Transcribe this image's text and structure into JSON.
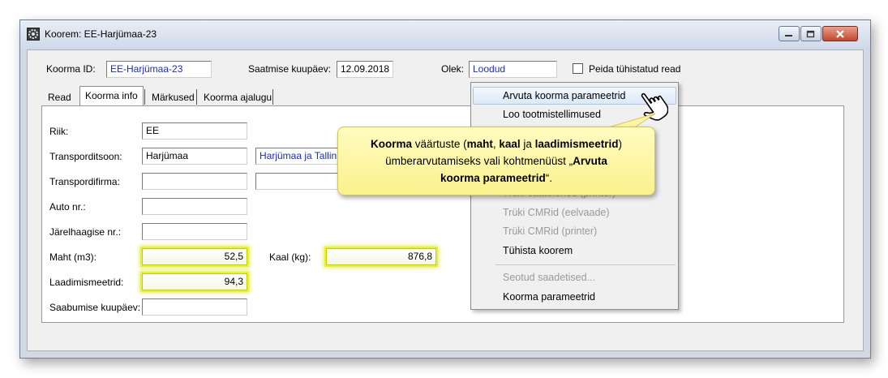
{
  "window": {
    "title": "Koorem: EE-Harjümaa-23"
  },
  "header": {
    "id_label": "Koorma ID:",
    "id_value": "EE-Harjümaa-23",
    "send_date_label": "Saatmise kuupäev:",
    "send_date_value": "12.09.2018",
    "status_label": "Olek:",
    "status_value": "Loodud",
    "hide_rows_label": "Peida tühistatud read"
  },
  "tabs": [
    {
      "label": "Read"
    },
    {
      "label": "Koorma info"
    },
    {
      "label": "Märkused"
    },
    {
      "label": "Koorma ajalugu"
    }
  ],
  "form": {
    "country_label": "Riik:",
    "country_value": "EE",
    "transport_zone_label": "Transporditsoon:",
    "transport_zone_value": "Harjümaa",
    "transport_zone_desc": "Harjümaa ja Tallinn",
    "transport_company_label": "Transpordifirma:",
    "transport_company_value": "",
    "car_label": "Auto nr.:",
    "car_value": "",
    "trailer_label": "Järelhaagise nr.:",
    "trailer_value": "",
    "volume_label": "Maht (m3):",
    "volume_value": "52,5",
    "weight_label": "Kaal (kg):",
    "weight_value": "876,8",
    "loading_meters_label": "Laadimismeetrid:",
    "loading_meters_value": "94,3",
    "arrival_date_label": "Saabumise kuupäev:",
    "arrival_date_value": ""
  },
  "context_menu": {
    "items": [
      {
        "label": "Arvuta koorma parameetrid",
        "state": "hover"
      },
      {
        "label": "Loo tootmistellimused",
        "state": "enabled"
      },
      {
        "label": "Trüki saatelehed (printer)",
        "state": "disabled"
      },
      {
        "label": "Trüki CMRid (eelvaade)",
        "state": "disabled"
      },
      {
        "label": "Trüki CMRid (printer)",
        "state": "disabled"
      },
      {
        "label": "Tühista koorem",
        "state": "enabled"
      },
      {
        "label": "Seotud saadetised...",
        "state": "disabled"
      },
      {
        "label": "Koorma parameetrid",
        "state": "enabled"
      }
    ]
  },
  "callout": {
    "line1_b1": "Koorma",
    "line1_t1": " väärtuste (",
    "line1_b2": "maht",
    "line1_t2": ", ",
    "line1_b3": "kaal",
    "line1_t3": " ja ",
    "line1_b4": "laadimismeetrid",
    "line1_t4": ")",
    "line2_t1": "ümberarvutamiseks vali kohtmenüüst „",
    "line2_b1": "Arvuta",
    "line3_b1": "koorma parameetrid",
    "line3_t1": "“."
  },
  "colors": {
    "highlight": "#e7f03a",
    "callout_fill": "#fbf18d",
    "link_text": "#1a2bc9"
  }
}
